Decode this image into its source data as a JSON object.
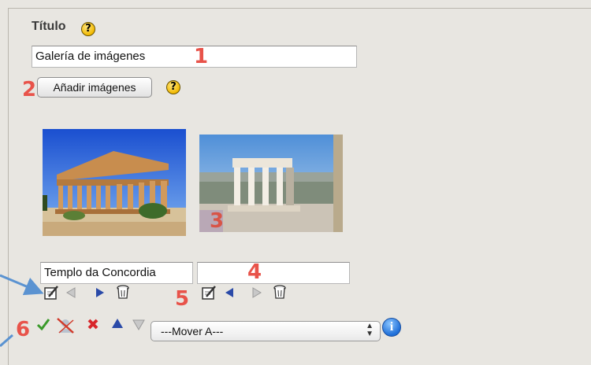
{
  "form": {
    "title_label": "Título",
    "title_value": "Galería de imágenes",
    "add_images_label": "Añadir imágenes",
    "help_glyph": "?"
  },
  "gallery": {
    "images": [
      {
        "caption": "Templo da Concordia",
        "alt": "temple-concordia-photo"
      },
      {
        "caption": "",
        "alt": "acropolis-erechtheion-photo"
      }
    ],
    "controls": [
      "edit-icon",
      "move-left-icon",
      "move-right-icon",
      "delete-icon"
    ]
  },
  "bulk": {
    "move_select_value": "---Mover A---",
    "info_glyph": "i",
    "icons": [
      "check-icon",
      "unpublish-icon",
      "delete-x-icon",
      "move-up-icon",
      "move-down-icon"
    ]
  },
  "annotations": [
    "1",
    "2",
    "3",
    "4",
    "5",
    "6"
  ],
  "colors": {
    "background": "#e8e6e1",
    "annotation": "#e8534a",
    "arrow": "#5b93d1"
  }
}
